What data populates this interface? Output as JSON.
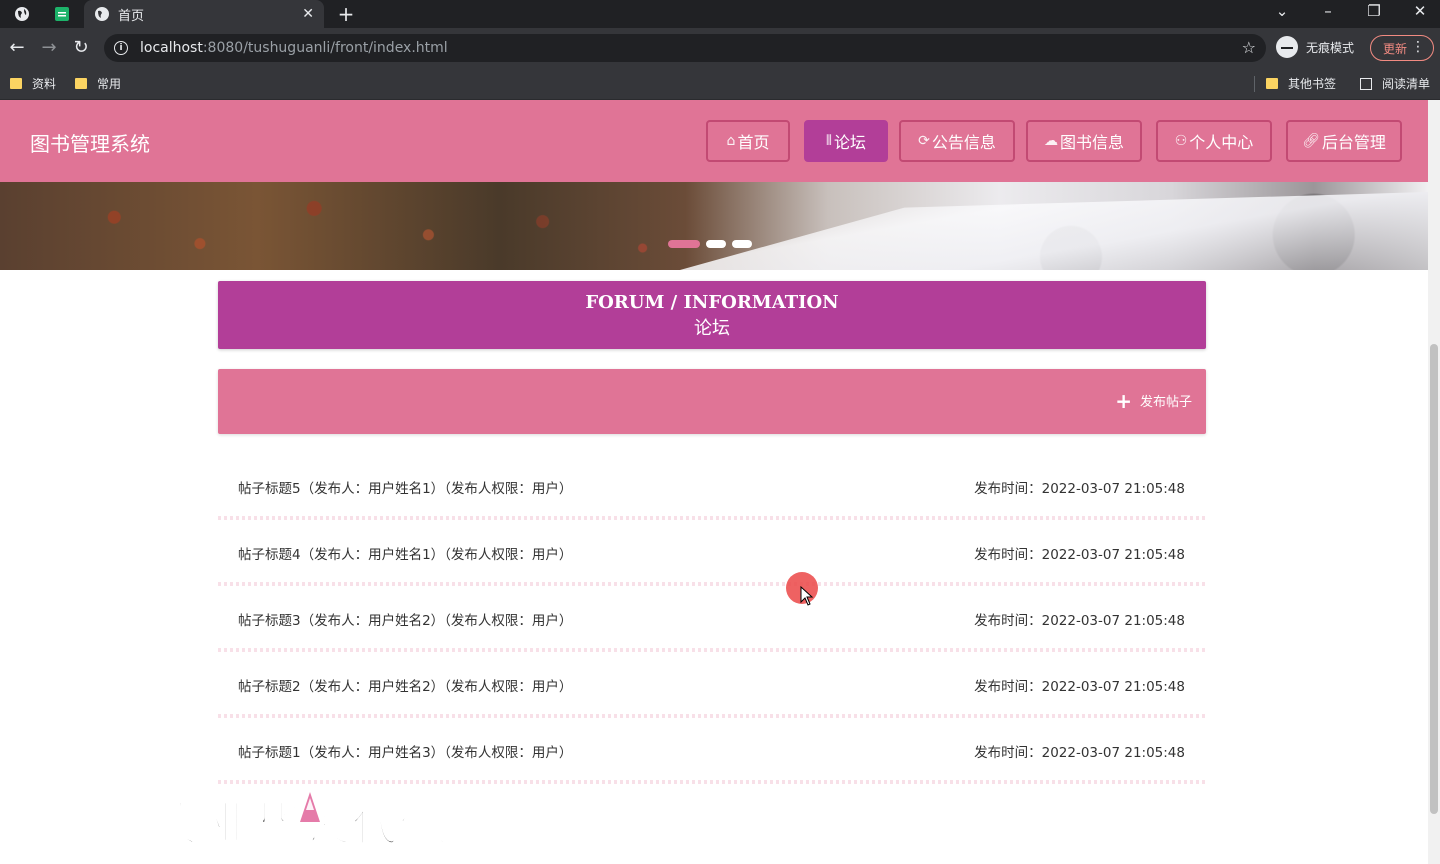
{
  "browser": {
    "tab_title": "首页",
    "url_host": "localhost",
    "url_path": ":8080/tushuguanli/front/index.html",
    "incognito_label": "无痕模式",
    "update_label": "更新",
    "bookmarks": [
      {
        "label": "资料",
        "icon": "folder-icon"
      },
      {
        "label": "常用",
        "icon": "folder-icon"
      }
    ],
    "other_bookmarks": "其他书签",
    "reading_list": "阅读清单"
  },
  "header": {
    "site_title": "图书管理系统",
    "nav": [
      {
        "label": "首页",
        "icon": "home-icon",
        "active": false
      },
      {
        "label": "论坛",
        "icon": "forum-icon",
        "active": true
      },
      {
        "label": "公告信息",
        "icon": "announcement-icon",
        "active": false
      },
      {
        "label": "图书信息",
        "icon": "book-icon",
        "active": false
      },
      {
        "label": "个人中心",
        "icon": "user-icon",
        "active": false
      },
      {
        "label": "后台管理",
        "icon": "link-icon",
        "active": false
      }
    ]
  },
  "forum": {
    "title_en": "FORUM / INFORMATION",
    "title_cn": "论坛",
    "post_button": "发布帖子"
  },
  "posts": [
    {
      "title": "帖子标题5（发布人：用户姓名1）（发布人权限：用户）",
      "time": "发布时间：2022-03-07 21:05:48"
    },
    {
      "title": "帖子标题4（发布人：用户姓名1）（发布人权限：用户）",
      "time": "发布时间：2022-03-07 21:05:48"
    },
    {
      "title": "帖子标题3（发布人：用户姓名2）（发布人权限：用户）",
      "time": "发布时间：2022-03-07 21:05:48"
    },
    {
      "title": "帖子标题2（发布人：用户姓名2）（发布人权限：用户）",
      "time": "发布时间：2022-03-07 21:05:48"
    },
    {
      "title": "帖子标题1（发布人：用户姓名3）（发布人权限：用户）",
      "time": "发布时间：2022-03-07 21:05:48"
    }
  ],
  "watermark": "专业毕设代做",
  "colors": {
    "header_pink": "#e07496",
    "accent_purple": "#b23e98"
  }
}
